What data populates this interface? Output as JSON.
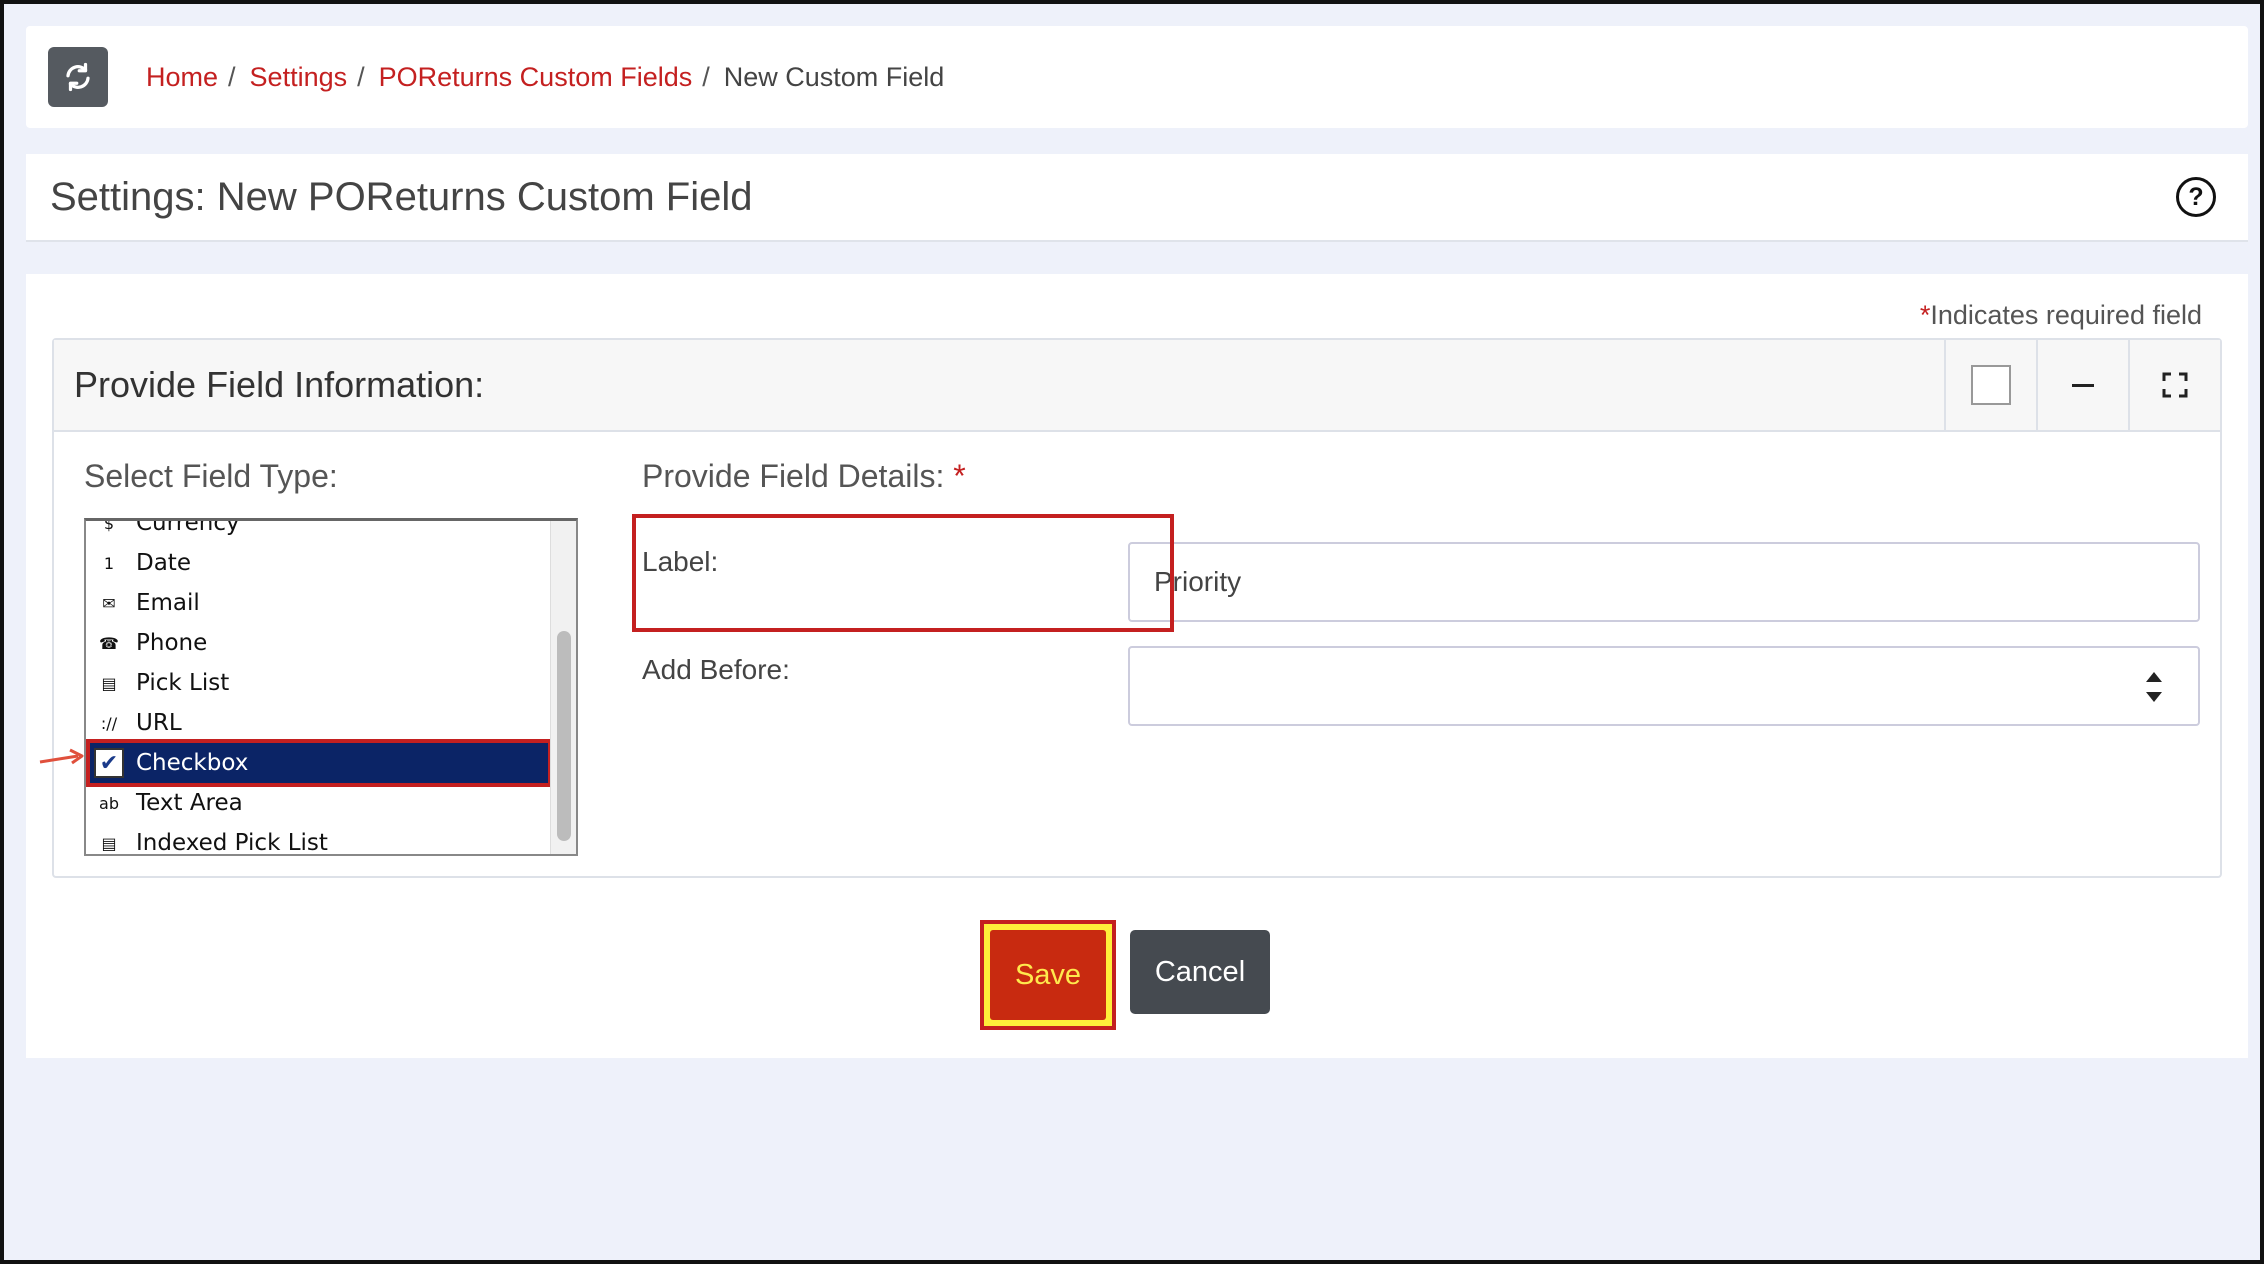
{
  "breadcrumb": {
    "home": "Home",
    "settings": "Settings",
    "custom_fields": "POReturns Custom Fields",
    "current": "New Custom Field",
    "separator": "/"
  },
  "page": {
    "title": "Settings: New POReturns Custom Field",
    "help_icon": "?"
  },
  "form": {
    "required_star": "*",
    "required_note": "Indicates required field",
    "panel_title": "Provide Field Information:",
    "select_type_label": "Select Field Type:",
    "details_label": "Provide Field Details:",
    "details_star": "*",
    "field_types": [
      {
        "label": "Currency",
        "icon": "currency-icon",
        "glyph": "$"
      },
      {
        "label": "Date",
        "icon": "calendar-icon",
        "glyph": "1"
      },
      {
        "label": "Email",
        "icon": "envelope-icon",
        "glyph": "✉"
      },
      {
        "label": "Phone",
        "icon": "phone-icon",
        "glyph": "☎"
      },
      {
        "label": "Pick List",
        "icon": "pick-list-icon",
        "glyph": "▤"
      },
      {
        "label": "URL",
        "icon": "url-icon",
        "glyph": "://"
      },
      {
        "label": "Checkbox",
        "icon": "checkbox-icon",
        "glyph": "✔"
      },
      {
        "label": "Text Area",
        "icon": "text-area-icon",
        "glyph": "ab"
      },
      {
        "label": "Indexed Pick List",
        "icon": "indexed-pick-list-icon",
        "glyph": "▤"
      }
    ],
    "selected_type": "Checkbox",
    "label_field_label": "Label:",
    "label_value": "Priority",
    "add_before_label": "Add Before:",
    "add_before_value": "",
    "save_label": "Save",
    "cancel_label": "Cancel"
  }
}
